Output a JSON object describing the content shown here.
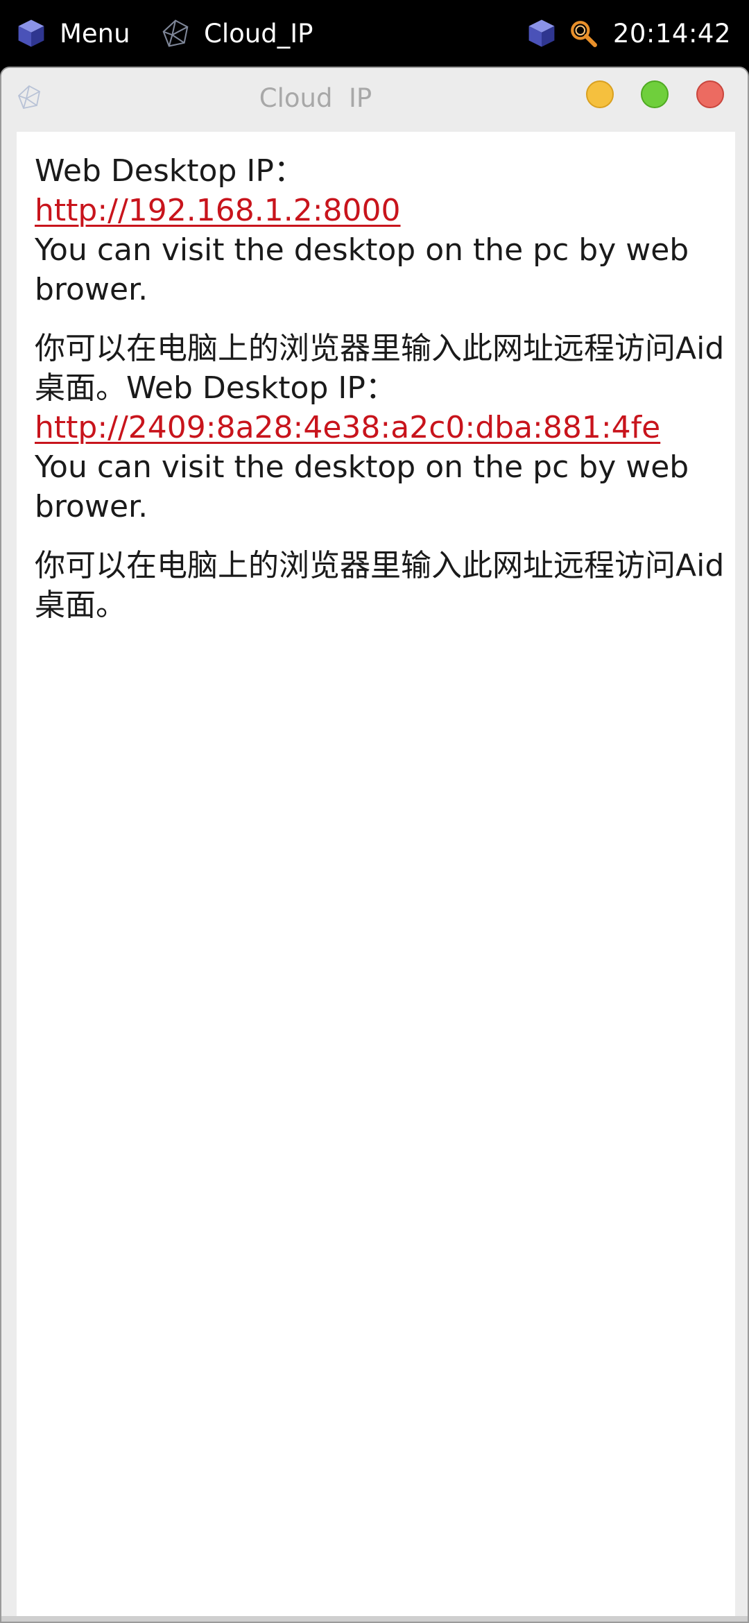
{
  "taskbar": {
    "menu_label": "Menu",
    "app_label": "Cloud_IP",
    "clock": "20:14:42"
  },
  "window": {
    "title": "Cloud  IP"
  },
  "content": {
    "block1": {
      "label": "Web Desktop IP：",
      "link": "http://192.168.1.2:8000 ",
      "desc": "You can visit the desktop on the pc by web brower.",
      "desc_cn": "你可以在电脑上的浏览器里输入此网址远程访问Aid桌面。"
    },
    "block2": {
      "label": "Web Desktop IP：",
      "link": "http://2409:8a28:4e38:a2c0:dba:881:4fe",
      "desc": "You can visit the desktop on the pc by web brower.",
      "desc_cn": "你可以在电脑上的浏览器里输入此网址远程访问Aid桌面。"
    }
  },
  "colors": {
    "link": "#c8141c",
    "minimize": "#f5c03e",
    "maximize": "#6fcf3c",
    "close": "#ec6b61"
  },
  "icons": [
    "cube-icon",
    "wireframe-icon",
    "search-icon"
  ]
}
